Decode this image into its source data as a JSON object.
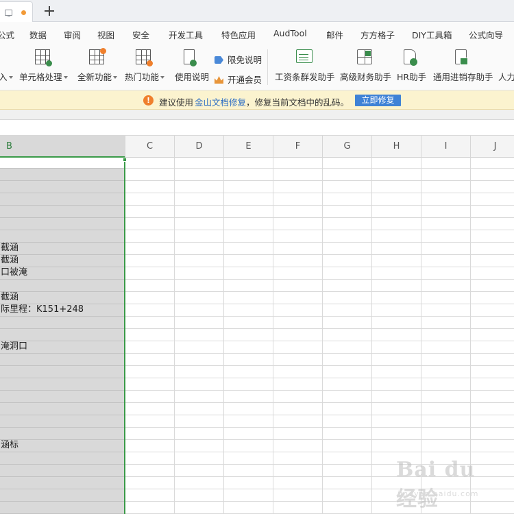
{
  "tab_bar": {
    "icons": [
      "doc-icon",
      "unsaved-dot",
      "plus-icon"
    ]
  },
  "menu": {
    "items": [
      "公式",
      "数据",
      "审阅",
      "视图",
      "安全",
      "开发工具",
      "特色应用",
      "AudTool",
      "邮件",
      "方方格子",
      "DIY工具箱",
      "公式向导"
    ]
  },
  "ribbon": {
    "partial_left": "入",
    "cell_processing": "单元格处理",
    "new_features": "全新功能",
    "hot_features": "热门功能",
    "usage_guide": "使用说明",
    "disclaimer": "限免说明",
    "open_member": "开通会员",
    "payroll_helper": "工资条群发助手",
    "finance_helper": "高级财务助手",
    "hr_helper": "HR助手",
    "inventory_helper": "通用进销存助手",
    "partial_right": "人力"
  },
  "notice": {
    "prefix": "建议使用",
    "link": "金山文档修复",
    "suffix": "，修复当前文档中的乱码。",
    "button": "立即修复",
    "colors": {
      "bar": "#fbf3cf",
      "button": "#3f82d6",
      "icon": "#ef7f2c"
    }
  },
  "columns": [
    "B",
    "C",
    "D",
    "E",
    "F",
    "G",
    "H",
    "I",
    "J"
  ],
  "selected_column": "B",
  "column_b_cells": [
    {
      "row": 7,
      "text": "截涵"
    },
    {
      "row": 8,
      "text": "截涵"
    },
    {
      "row": 9,
      "text": "口被淹"
    },
    {
      "row": 11,
      "text": "截涵"
    },
    {
      "row": 12,
      "text": "际里程：K151+248"
    },
    {
      "row": 15,
      "text": "淹洞口"
    },
    {
      "row": 23,
      "text": "涵标"
    }
  ],
  "watermark": {
    "main": "Bai du 经验",
    "sub": "jingyan.baidu.com"
  },
  "accent_color": "#3a9a48"
}
